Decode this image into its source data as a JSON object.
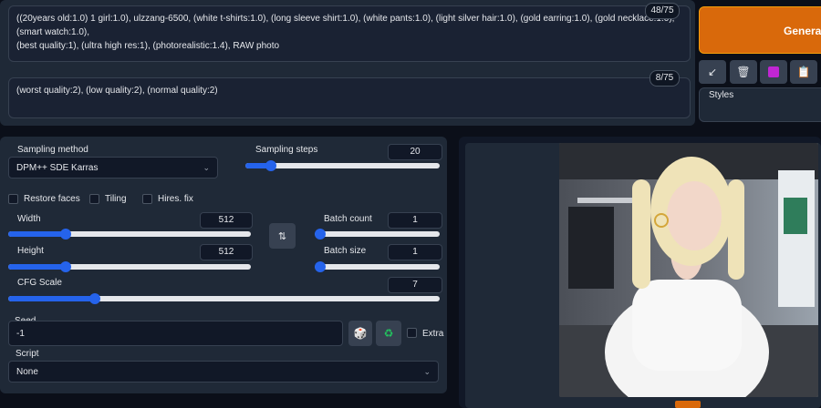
{
  "prompt": {
    "positive_text": "((20years old:1.0) 1 girl:1.0), ulzzang-6500, (white t-shirts:1.0), (long sleeve shirt:1.0), (white pants:1.0), (light silver hair:1.0), (gold earring:1.0), (gold necklace:1.0), (smart watch:1.0),\n(best quality:1), (ultra high res:1), (photorealistic:1.4), RAW photo",
    "positive_count": "48/75",
    "negative_text": "(worst quality:2), (low quality:2), (normal quality:2)",
    "negative_count": "8/75"
  },
  "actions": {
    "generate_label": "Generate",
    "styles_label": "Styles"
  },
  "settings": {
    "sampling_method_label": "Sampling method",
    "sampling_method_value": "DPM++ SDE Karras",
    "sampling_steps_label": "Sampling steps",
    "sampling_steps_value": "20",
    "sampling_steps_fraction": 0.13,
    "restore_faces_label": "Restore faces",
    "tiling_label": "Tiling",
    "hires_fix_label": "Hires. fix",
    "width_label": "Width",
    "width_value": "512",
    "width_fraction": 0.235,
    "height_label": "Height",
    "height_value": "512",
    "height_fraction": 0.235,
    "batch_count_label": "Batch count",
    "batch_count_value": "1",
    "batch_size_label": "Batch size",
    "batch_size_value": "1",
    "cfg_scale_label": "CFG Scale",
    "cfg_scale_value": "7",
    "cfg_scale_fraction": 0.2,
    "seed_label": "Seed",
    "seed_value": "-1",
    "extra_label": "Extra",
    "script_label": "Script",
    "script_value": "None"
  },
  "icons": {
    "dice": "dice-icon",
    "recycle": "recycle-icon",
    "swap": "swap-icon",
    "chevron": "chevron-down-icon"
  },
  "colors": {
    "accent": "#2563eb",
    "generate": "#d9690b"
  }
}
